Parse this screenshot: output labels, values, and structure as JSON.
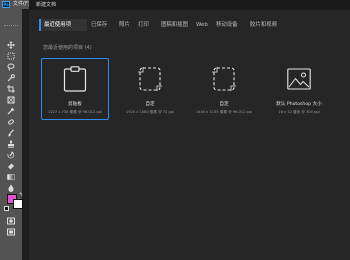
{
  "app": {
    "logo": "Ps",
    "menu_label": "文件(F)"
  },
  "dialog": {
    "title": "新建文档",
    "tabs": [
      {
        "label": "最近使用项",
        "active": true
      },
      {
        "label": "已保存",
        "active": false
      },
      {
        "label": "照片",
        "active": false
      },
      {
        "label": "打印",
        "active": false
      },
      {
        "label": "图稿和插图",
        "active": false
      },
      {
        "label": "Web",
        "active": false
      },
      {
        "label": "移动设备",
        "active": false
      },
      {
        "label": "胶片和视频",
        "active": false
      }
    ],
    "section_label": "您最近使用的项目 (4)",
    "presets": [
      {
        "name": "剪贴板",
        "detail": "1227 x 734 像素 @ 96.012 ppi",
        "icon": "clipboard-icon",
        "selected": true
      },
      {
        "name": "自定",
        "detail": "1920 x 1080 像素 @ 72 ppi",
        "icon": "custom-document-icon",
        "selected": false
      },
      {
        "name": "自定",
        "detail": "1440 x 1135 像素 @ 96.012 ppi",
        "icon": "custom-document-icon",
        "selected": false
      },
      {
        "name": "默认 Photoshop 大小",
        "detail": "16 x 12 厘米 @ 300 ppi",
        "icon": "image-document-icon",
        "selected": false
      }
    ]
  },
  "colors": {
    "foreground": "#e353d1",
    "background": "#ffffff",
    "accent": "#2d8ceb"
  }
}
